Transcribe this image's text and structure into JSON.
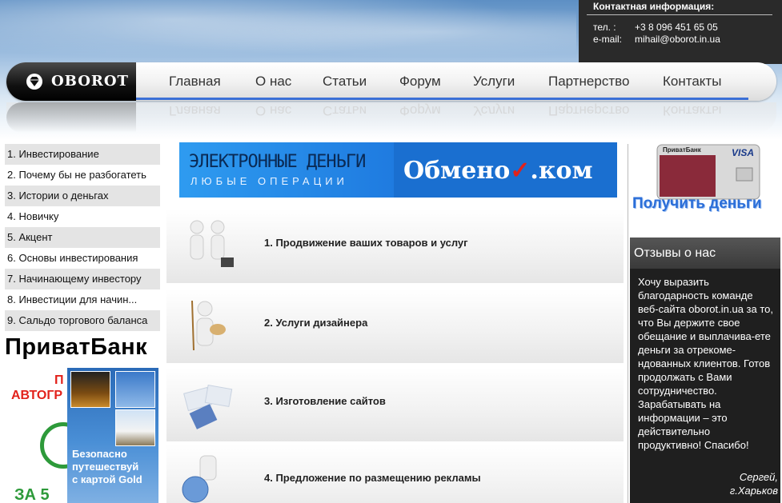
{
  "contact": {
    "title": "Контактная информация:",
    "phone_label": "тел. :",
    "phone": "+3 8 096 451 65 05",
    "email_label": "e-mail:",
    "email": "mihail@oborot.in.ua"
  },
  "logo": {
    "text": "OBOROT"
  },
  "nav": {
    "items": [
      {
        "label": "Главная"
      },
      {
        "label": "О нас"
      },
      {
        "label": "Статьи"
      },
      {
        "label": "Форум"
      },
      {
        "label": "Услуги"
      },
      {
        "label": "Партнерство"
      },
      {
        "label": "Контакты"
      }
    ]
  },
  "sidebar": {
    "items": [
      {
        "label": "1. Инвестирование"
      },
      {
        "label": "2. Почему бы не разбогатеть"
      },
      {
        "label": "3. Истории о деньгах"
      },
      {
        "label": "4. Новичку"
      },
      {
        "label": "5. Акцент"
      },
      {
        "label": "6. Основы инвестирования"
      },
      {
        "label": "7. Начинающему инвестору"
      },
      {
        "label": "8. Инвестиции для начин..."
      },
      {
        "label": "9. Сальдо торгового баланса"
      }
    ],
    "bank_title": "ПриватБанк",
    "bank_banner": {
      "line1": "П",
      "line2": "АВТОГР",
      "line3": "ЗА 5",
      "card_text_1": "Безопасно",
      "card_text_2": "путешествуй",
      "card_text_3": "с картой Gold"
    }
  },
  "banner": {
    "title": "ЭЛЕКТРОННЫЕ ДЕНЬГИ",
    "subtitle": "ЛЮБЫЕ ОПЕРАЦИИ",
    "brand_start": "Обмено",
    "brand_check": "✓",
    "brand_end": ".ком"
  },
  "services": [
    {
      "title": "1. Продвижение ваших товаров и услуг"
    },
    {
      "title": "2. Услуги дизайнера"
    },
    {
      "title": "3. Изготовление сайтов"
    },
    {
      "title": "4. Предложение по размещению рекламы"
    }
  ],
  "right": {
    "card_bank": "ПриватБанк",
    "card_brand": "VISA",
    "get_money": "Получить деньги",
    "reviews_title": "Отзывы о нас",
    "reviews_text": "Хочу выразить благодарность команде веб-сайта oborot.in.ua за то, что Вы держите свое обещание и выплачива-ете деньги за отрекоме-ндованных клиентов. Готов продолжать с Вами сотрудничество. Зарабатывать на информации – это действительно продуктивно! Спасибо!",
    "reviews_author": "Сергей,",
    "reviews_city": "г.Харьков"
  },
  "colors": {
    "accent_blue": "#3b6fd6",
    "banner_blue": "#1f7be0",
    "red": "#e2221b",
    "green": "#2d9a3a",
    "dark": "#1f1f1f"
  }
}
